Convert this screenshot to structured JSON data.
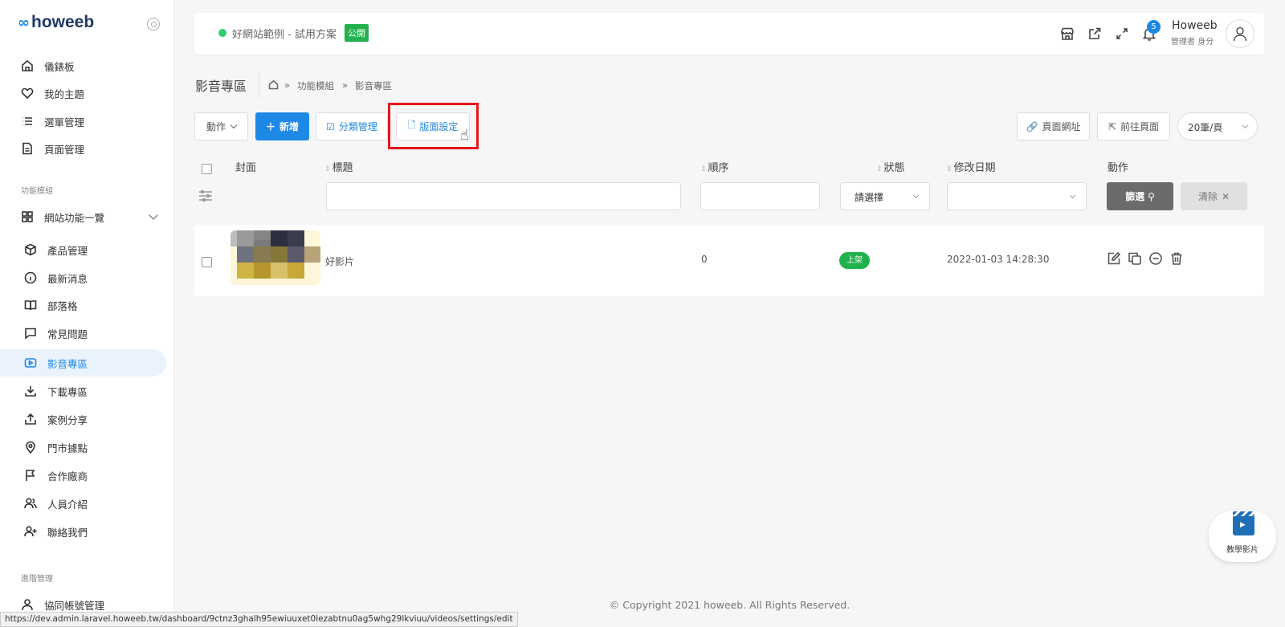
{
  "brand": {
    "mark": "∞",
    "name": "howeeb"
  },
  "sidebar": {
    "items": [
      {
        "label": "儀錶板",
        "icon": "home-icon"
      },
      {
        "label": "我的主題",
        "icon": "heart-icon"
      },
      {
        "label": "選單管理",
        "icon": "list-icon"
      },
      {
        "label": "頁面管理",
        "icon": "file-icon"
      }
    ],
    "section_modules": "功能模組",
    "group_label": "網站功能一覽",
    "module_items": [
      {
        "label": "產品管理",
        "icon": "box-icon"
      },
      {
        "label": "最新消息",
        "icon": "info-icon"
      },
      {
        "label": "部落格",
        "icon": "book-icon"
      },
      {
        "label": "常見問題",
        "icon": "message-icon"
      },
      {
        "label": "影音專區",
        "icon": "video-icon",
        "active": true
      },
      {
        "label": "下載專區",
        "icon": "download-icon"
      },
      {
        "label": "案例分享",
        "icon": "share-icon"
      },
      {
        "label": "門市據點",
        "icon": "map-pin-icon"
      },
      {
        "label": "合作廠商",
        "icon": "flag-icon"
      },
      {
        "label": "人員介紹",
        "icon": "users-icon"
      },
      {
        "label": "聯絡我們",
        "icon": "user-plus-icon"
      }
    ],
    "section_admin": "進階管理",
    "admin_items": [
      {
        "label": "協同帳號管理",
        "icon": "user-icon"
      }
    ]
  },
  "topbar": {
    "site_name": "好網站範例 - 試用方案",
    "site_badge": "公開",
    "notification_count": "5",
    "user_name": "Howeeb",
    "user_role": "管理者 身分"
  },
  "page": {
    "title": "影音專區",
    "breadcrumb": [
      "功能模組",
      "影音專區"
    ],
    "breadcrumb_sep": "»"
  },
  "toolbar": {
    "action_label": "動作",
    "add_label": "新增",
    "category_label": "分類管理",
    "layout_label": "版面設定",
    "page_url_label": "頁面網址",
    "goto_page_label": "前往頁面",
    "per_page": "20筆/頁"
  },
  "table": {
    "columns": [
      "封面",
      "標題",
      "順序",
      "狀態",
      "修改日期",
      "動作"
    ],
    "status_placeholder": "請選擇",
    "filter_label": "篩選",
    "clear_label": "清除",
    "rows": [
      {
        "title": "好影片",
        "order": "0",
        "status": "上架",
        "modified": "2022-01-03 14:28:30"
      }
    ]
  },
  "footer": {
    "copyright": "© Copyright 2021 howeeb. All Rights Reserved."
  },
  "statusbar_url": "https://dev.admin.laravel.howeeb.tw/dashboard/9ctnz3ghalh95ewiuuxet0lezabtnu0ag5whg29lkviuu/videos/settings/edit",
  "tutorial_label": "教學影片",
  "colors": {
    "accent": "#1e88e5",
    "success": "#22b14c",
    "highlight": "#e3161c"
  }
}
